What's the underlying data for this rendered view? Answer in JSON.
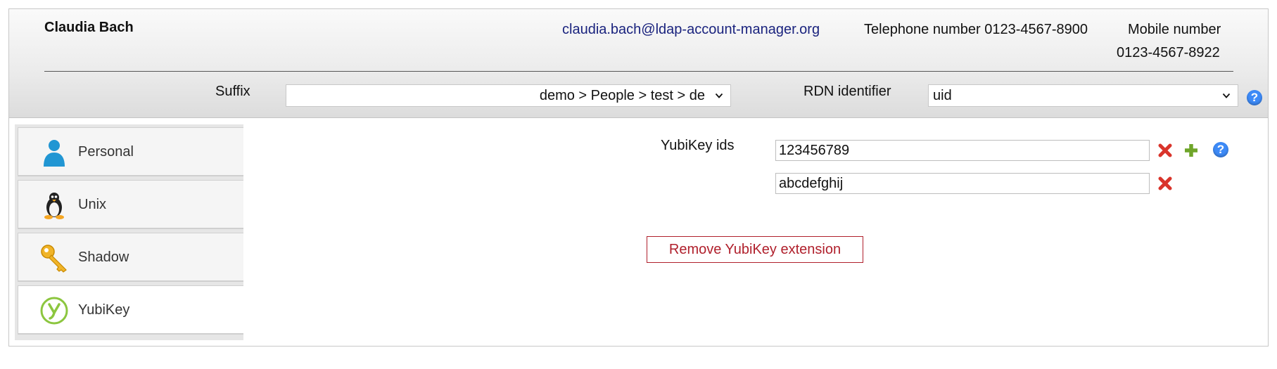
{
  "header": {
    "user_name": "Claudia Bach",
    "email": "claudia.bach@ldap-account-manager.org",
    "telephone": "Telephone number 0123-4567-8900",
    "mobile_label": "Mobile number",
    "mobile_value": "0123-4567-8922",
    "suffix_label": "Suffix",
    "suffix_value": "demo > People > test > de",
    "rdn_label": "RDN identifier",
    "rdn_value": "uid",
    "help_glyph": "?"
  },
  "tabs": [
    {
      "label": "Personal",
      "icon": "person-icon",
      "active": false
    },
    {
      "label": "Unix",
      "icon": "penguin-icon",
      "active": false
    },
    {
      "label": "Shadow",
      "icon": "key-icon",
      "active": false
    },
    {
      "label": "YubiKey",
      "icon": "yubikey-icon",
      "active": true
    }
  ],
  "content": {
    "yubikey_label": "YubiKey ids",
    "ids": [
      "123456789",
      "abcdefghij"
    ],
    "remove_button": "Remove YubiKey extension"
  },
  "colors": {
    "accent_blue": "#3d8af7",
    "link": "#1a237e",
    "danger": "#b0202c",
    "delete_red": "#d9342b",
    "add_green": "#6fa52a"
  }
}
